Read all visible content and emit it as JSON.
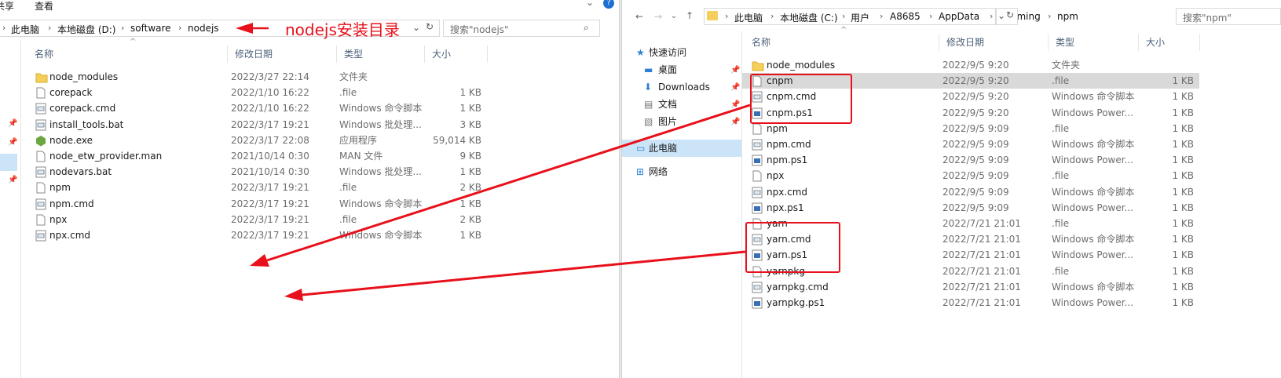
{
  "left": {
    "menu": {
      "share": "共享",
      "view": "查看"
    },
    "breadcrumb": [
      "此电脑",
      "本地磁盘 (D:)",
      "software",
      "nodejs"
    ],
    "search_placeholder": "搜索\"nodejs\"",
    "columns": {
      "name": "名称",
      "date": "修改日期",
      "type": "类型",
      "size": "大小"
    },
    "files": [
      {
        "name": "node_modules",
        "date": "2022/3/27 22:14",
        "type": "文件夹",
        "size": "",
        "icon": "folder-icon"
      },
      {
        "name": "corepack",
        "date": "2022/1/10 16:22",
        "type": ".file",
        "size": "1 KB",
        "icon": "file-icon"
      },
      {
        "name": "corepack.cmd",
        "date": "2022/1/10 16:22",
        "type": "Windows 命令脚本",
        "size": "1 KB",
        "icon": "script-icon"
      },
      {
        "name": "install_tools.bat",
        "date": "2022/3/17 19:21",
        "type": "Windows 批处理...",
        "size": "3 KB",
        "icon": "script-icon"
      },
      {
        "name": "node.exe",
        "date": "2022/3/17 22:08",
        "type": "应用程序",
        "size": "59,014 KB",
        "icon": "node-exe-icon"
      },
      {
        "name": "node_etw_provider.man",
        "date": "2021/10/14 0:30",
        "type": "MAN 文件",
        "size": "9 KB",
        "icon": "file-icon"
      },
      {
        "name": "nodevars.bat",
        "date": "2021/10/14 0:30",
        "type": "Windows 批处理...",
        "size": "1 KB",
        "icon": "script-icon"
      },
      {
        "name": "npm",
        "date": "2022/3/17 19:21",
        "type": ".file",
        "size": "2 KB",
        "icon": "file-icon"
      },
      {
        "name": "npm.cmd",
        "date": "2022/3/17 19:21",
        "type": "Windows 命令脚本",
        "size": "1 KB",
        "icon": "script-icon"
      },
      {
        "name": "npx",
        "date": "2022/3/17 19:21",
        "type": ".file",
        "size": "2 KB",
        "icon": "file-icon"
      },
      {
        "name": "npx.cmd",
        "date": "2022/3/17 19:21",
        "type": "Windows 命令脚本",
        "size": "1 KB",
        "icon": "script-icon"
      }
    ]
  },
  "annotation": "nodejs安装目录",
  "right": {
    "breadcrumb": [
      "此电脑",
      "本地磁盘 (C:)",
      "用户",
      "A8685",
      "AppData",
      "Roaming",
      "npm"
    ],
    "search_placeholder": "搜索\"npm\"",
    "columns": {
      "name": "名称",
      "date": "修改日期",
      "type": "类型",
      "size": "大小"
    },
    "nav": [
      {
        "label": "快速访问",
        "icon": "star-icon"
      },
      {
        "label": "桌面",
        "icon": "desktop-icon"
      },
      {
        "label": "Downloads",
        "icon": "download-icon"
      },
      {
        "label": "文档",
        "icon": "document-icon"
      },
      {
        "label": "图片",
        "icon": "picture-icon"
      },
      {
        "label": "此电脑",
        "icon": "computer-icon"
      },
      {
        "label": "网络",
        "icon": "network-icon"
      }
    ],
    "files": [
      {
        "name": "node_modules",
        "date": "2022/9/5 9:20",
        "type": "文件夹",
        "size": "",
        "icon": "folder-icon"
      },
      {
        "name": "cnpm",
        "date": "2022/9/5 9:20",
        "type": ".file",
        "size": "1 KB",
        "icon": "file-icon"
      },
      {
        "name": "cnpm.cmd",
        "date": "2022/9/5 9:20",
        "type": "Windows 命令脚本",
        "size": "1 KB",
        "icon": "script-icon"
      },
      {
        "name": "cnpm.ps1",
        "date": "2022/9/5 9:20",
        "type": "Windows Power...",
        "size": "1 KB",
        "icon": "powershell-icon"
      },
      {
        "name": "npm",
        "date": "2022/9/5 9:09",
        "type": ".file",
        "size": "1 KB",
        "icon": "file-icon"
      },
      {
        "name": "npm.cmd",
        "date": "2022/9/5 9:09",
        "type": "Windows 命令脚本",
        "size": "1 KB",
        "icon": "script-icon"
      },
      {
        "name": "npm.ps1",
        "date": "2022/9/5 9:09",
        "type": "Windows Power...",
        "size": "1 KB",
        "icon": "powershell-icon"
      },
      {
        "name": "npx",
        "date": "2022/9/5 9:09",
        "type": ".file",
        "size": "1 KB",
        "icon": "file-icon"
      },
      {
        "name": "npx.cmd",
        "date": "2022/9/5 9:09",
        "type": "Windows 命令脚本",
        "size": "1 KB",
        "icon": "script-icon"
      },
      {
        "name": "npx.ps1",
        "date": "2022/9/5 9:09",
        "type": "Windows Power...",
        "size": "1 KB",
        "icon": "powershell-icon"
      },
      {
        "name": "yarn",
        "date": "2022/7/21 21:01",
        "type": ".file",
        "size": "1 KB",
        "icon": "file-icon"
      },
      {
        "name": "yarn.cmd",
        "date": "2022/7/21 21:01",
        "type": "Windows 命令脚本",
        "size": "1 KB",
        "icon": "script-icon"
      },
      {
        "name": "yarn.ps1",
        "date": "2022/7/21 21:01",
        "type": "Windows Power...",
        "size": "1 KB",
        "icon": "powershell-icon"
      },
      {
        "name": "yarnpkg",
        "date": "2022/7/21 21:01",
        "type": ".file",
        "size": "1 KB",
        "icon": "file-icon"
      },
      {
        "name": "yarnpkg.cmd",
        "date": "2022/7/21 21:01",
        "type": "Windows 命令脚本",
        "size": "1 KB",
        "icon": "script-icon"
      },
      {
        "name": "yarnpkg.ps1",
        "date": "2022/7/21 21:01",
        "type": "Windows Power...",
        "size": "1 KB",
        "icon": "powershell-icon"
      }
    ]
  },
  "colors": {
    "annotation": "#e8101a",
    "selected_row": "#d9d9d9",
    "selected_nav": "#cce4f7",
    "header_text": "#4c607a",
    "folder": "#f5cf5b"
  }
}
